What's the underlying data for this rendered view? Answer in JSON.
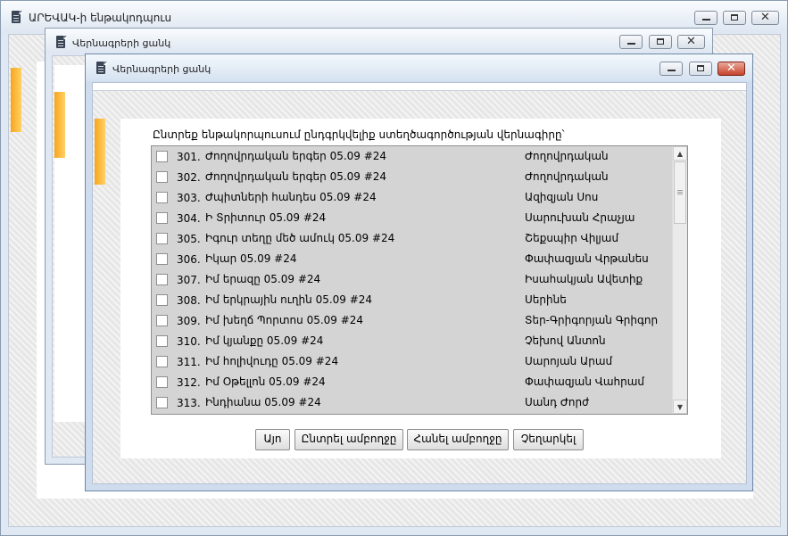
{
  "app": {
    "title": "ԱՐԵՎԱԿ-ի ենթակոդպուս"
  },
  "middle_window": {
    "title": "Վերնագրերի ցանկ"
  },
  "dialog": {
    "title": "Վերնագրերի ցանկ",
    "prompt": "Ընտրեք ենթակորպուսում ընդգրկվելիք ստեղծագործության վերնագիրը՝",
    "rows": [
      {
        "num": "301.",
        "title": "Ժողովրդական երգեր 05.09 #24",
        "author": "Ժողովրդական",
        "checked": false
      },
      {
        "num": "302.",
        "title": "Ժողովրդական երգեր 05.09 #24",
        "author": "Ժողովրդական",
        "checked": false
      },
      {
        "num": "303.",
        "title": "Ժպիտների հանդես 05.09 #24",
        "author": "Ազիզյան Սոս",
        "checked": false
      },
      {
        "num": "304.",
        "title": "Ի Տրիտուր 05.09 #24",
        "author": "Սարուխան Հրաչյա",
        "checked": false
      },
      {
        "num": "305.",
        "title": "Իգուր տեղը մեծ ամուկ 05.09 #24",
        "author": "Շեքսպիր Վիլյամ",
        "checked": false
      },
      {
        "num": "306.",
        "title": "Իկար 05.09 #24",
        "author": "Փափազյան Վրթանես",
        "checked": false
      },
      {
        "num": "307.",
        "title": "Իմ երազը 05.09 #24",
        "author": "Իսահակյան Ավետիք",
        "checked": false
      },
      {
        "num": "308.",
        "title": "Իմ երկրային ուղին 05.09 #24",
        "author": "Սերինե",
        "checked": false
      },
      {
        "num": "309.",
        "title": "Իմ խեղճ Պորտոս 05.09 #24",
        "author": "Տեր-Գրիգորյան Գրիգոր",
        "checked": false
      },
      {
        "num": "310.",
        "title": "Իմ կյանքը 05.09 #24",
        "author": "Չեխով Անտոն",
        "checked": false
      },
      {
        "num": "311.",
        "title": "Իմ հոլիվուդը 05.09 #24",
        "author": "Սարոյան Արամ",
        "checked": false
      },
      {
        "num": "312.",
        "title": "Իմ Օթելլոն 05.09 #24",
        "author": "Փափազյան Վահրամ",
        "checked": false
      },
      {
        "num": "313.",
        "title": "Ինդիանա 05.09 #24",
        "author": "Սանդ Ժորժ",
        "checked": false
      }
    ],
    "buttons": {
      "ok": "Այո",
      "select_all": "Ընտրել ամբողջը",
      "deselect_all": "Հանել ամբողջը",
      "cancel": "Չեղարկել"
    }
  },
  "icons": {
    "window_icon": "document-icon",
    "minimize": "minimize-icon",
    "maximize": "maximize-icon",
    "close": "close-icon",
    "scroll_up": "scroll-up-arrow-icon",
    "scroll_down": "scroll-down-arrow-icon"
  },
  "colors": {
    "title_gradient_top": "#fdfdfe",
    "title_gradient_bottom": "#e3ebf5",
    "list_background": "#d4d4d4",
    "accent_tab": "#f7a51c",
    "close_button": "#c7432b"
  }
}
